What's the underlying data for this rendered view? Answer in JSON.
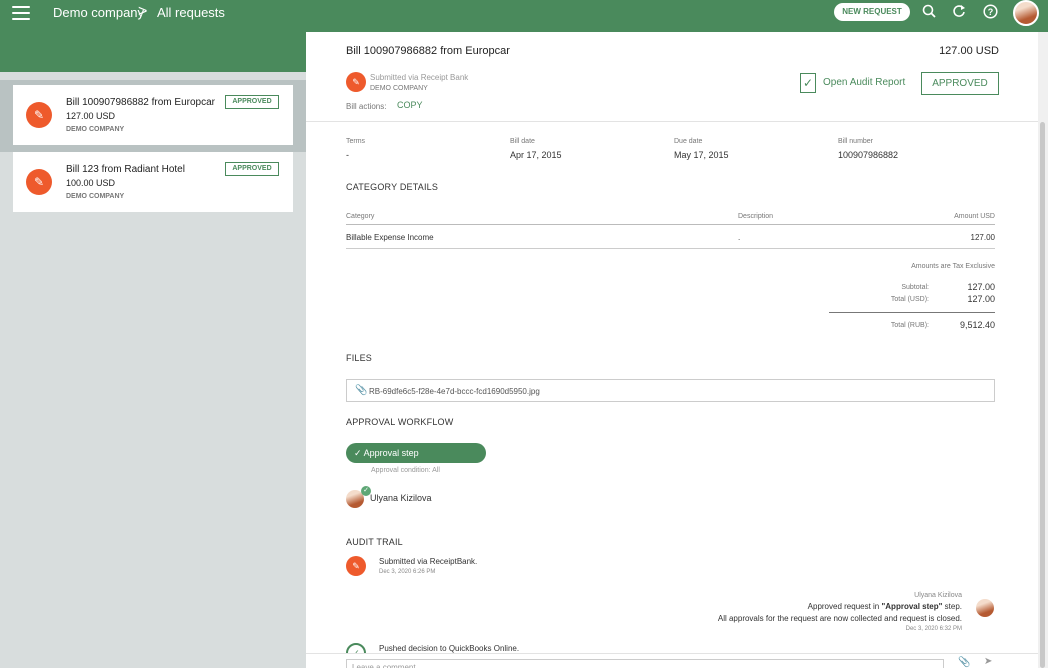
{
  "topbar": {
    "company": "Demo company",
    "separator": ">",
    "page": "All requests",
    "new_request_label": "NEW REQUEST",
    "icons": [
      "search-icon",
      "refresh-icon",
      "help-icon"
    ],
    "accent_color": "#4a8a5c"
  },
  "requests": [
    {
      "title": "Bill 100907986882 from Europcar",
      "amount": "127.00 USD",
      "company": "DEMO COMPANY",
      "status": "APPROVED",
      "selected": true
    },
    {
      "title": "Bill 123 from Radiant Hotel",
      "amount": "100.00 USD",
      "company": "DEMO COMPANY",
      "status": "APPROVED",
      "selected": false
    }
  ],
  "detail": {
    "title": "Bill 100907986882 from Europcar",
    "amount": "127.00 USD",
    "submitted_via": "Submitted via Receipt Bank",
    "company": "DEMO COMPANY",
    "bill_actions_label": "Bill actions:",
    "copy_label": "COPY",
    "audit_report_label": "Open Audit Report",
    "status_label": "APPROVED",
    "fields": {
      "terms_label": "Terms",
      "terms_value": "-",
      "bill_date_label": "Bill date",
      "bill_date_value": "Apr 17, 2015",
      "due_date_label": "Due date",
      "due_date_value": "May 17, 2015",
      "bill_number_label": "Bill number",
      "bill_number_value": "100907986882"
    },
    "category_section": "CATEGORY DETAILS",
    "category_table": {
      "headers": [
        "Category",
        "Description",
        "Amount USD"
      ],
      "rows": [
        [
          "Billable Expense Income",
          ".",
          "127.00"
        ]
      ]
    },
    "totals": {
      "tax_note": "Amounts are Tax Exclusive",
      "subtotal_label": "Subtotal:",
      "subtotal_value": "127.00",
      "total_usd_label": "Total (USD):",
      "total_usd_value": "127.00",
      "total_rub_label": "Total (RUB):",
      "total_rub_value": "9,512.40"
    },
    "files_section": "FILES",
    "file_name": "RB-69dfe6c5-f28e-4e7d-bccc-fcd1690d5950.jpg",
    "workflow_section": "APPROVAL WORKFLOW",
    "step_label": "Approval step",
    "approval_condition": "Approval condition: All",
    "approver_name": "Ulyana Kizilova",
    "audit_section": "AUDIT TRAIL",
    "trail": {
      "entry1_text": "Submitted via ReceiptBank.",
      "entry1_date": "Dec 3, 2020 6:26 PM",
      "entry2_author": "Ulyana Kizilova",
      "entry2_prefix": "Approved request in ",
      "entry2_step": "\"Approval step\"",
      "entry2_suffix": " step.",
      "entry2_line2": "All approvals for the request are now collected and request is closed.",
      "entry2_date": "Dec 3, 2020 6:32 PM",
      "entry3_text": "Pushed decision to QuickBooks Online."
    },
    "comment_placeholder": "Leave a comment..."
  }
}
